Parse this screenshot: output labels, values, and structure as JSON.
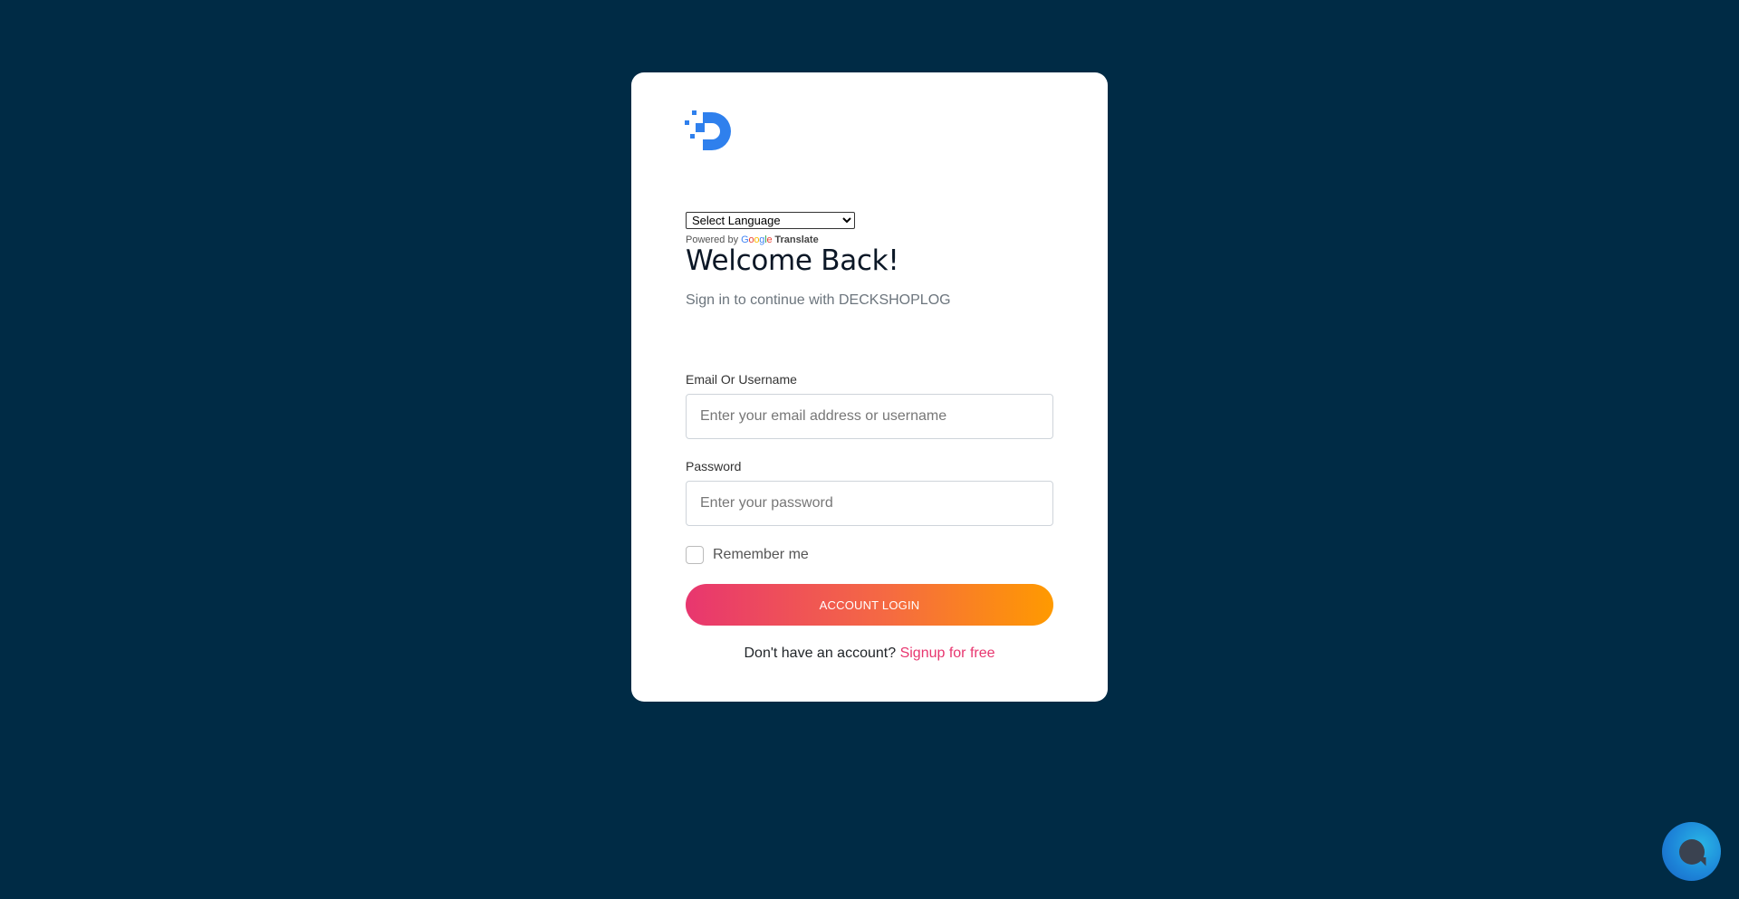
{
  "brand": {
    "logo_icon": "deckshoplog-d-logo-icon",
    "accent_color": "#2f80ed"
  },
  "language": {
    "selected": "Select Language",
    "powered_by": "Powered by",
    "google": "Google",
    "translate": "Translate"
  },
  "login": {
    "title": "Welcome Back!",
    "subtitle": "Sign in to continue with DECKSHOPLOG",
    "email_label": "Email Or Username",
    "email_placeholder": "Enter your email address or username",
    "email_value": "",
    "password_label": "Password",
    "password_placeholder": "Enter your password",
    "password_value": "",
    "remember_label": "Remember me",
    "remember_checked": false,
    "submit_label": "ACCOUNT LOGIN",
    "button_gradient": [
      "#e8366f",
      "#ff9a00"
    ],
    "no_account_text": "Don't have an account?",
    "signup_link": "Signup for free",
    "link_color": "#e8366f"
  },
  "chat_widget": {
    "icon": "chat-bubble-icon"
  },
  "colors": {
    "background": "#002b45",
    "card": "#ffffff"
  }
}
